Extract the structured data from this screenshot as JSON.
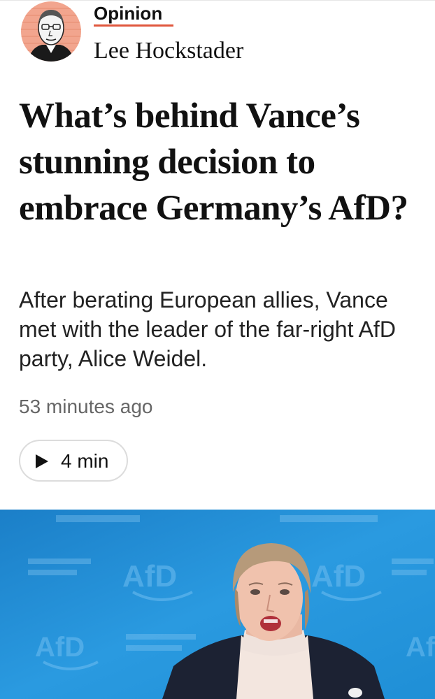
{
  "byline": {
    "section_label": "Opinion",
    "author_name": "Lee Hockstader",
    "avatar_alt": "Lee Hockstader"
  },
  "article": {
    "headline": "What’s behind Vance’s stunning decision to embrace Germany’s AfD?",
    "dek": "After berating European allies, Vance met with the leader of the far-right AfD party, Alice Weidel.",
    "timestamp": "53 minutes ago"
  },
  "audio": {
    "label": "4 min",
    "icon": "play-icon"
  },
  "photo": {
    "backdrop_logo_text": "AfD",
    "description_icon": "article-photo"
  },
  "colors": {
    "accent_underline": "#e0573d",
    "avatar_background": "#f2a58e",
    "backdrop_blue": "#1f8fd6",
    "text": "#111111",
    "muted_text": "#666666"
  }
}
